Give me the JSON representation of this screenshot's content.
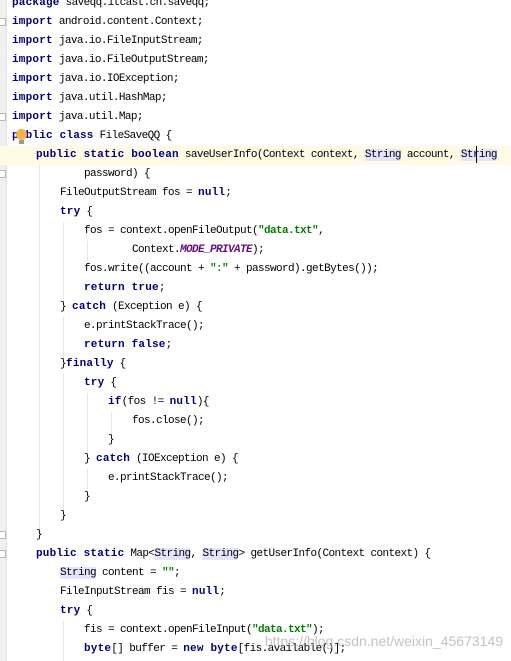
{
  "editor": {
    "current_line": 8,
    "colors": {
      "keyword": "#000080",
      "string": "#008000",
      "constant": "#660e7a",
      "highlight": "#e4e4ff",
      "current_line": "#fffae3"
    },
    "lines": [
      {
        "indent": 0,
        "tokens": [
          [
            "package",
            "k"
          ],
          [
            " saveqq.itcast.cn.saveqq;",
            "p"
          ]
        ]
      },
      {
        "indent": 0,
        "tokens": [
          [
            "import",
            "k"
          ],
          [
            " android.content.Context;",
            "p"
          ]
        ]
      },
      {
        "indent": 0,
        "tokens": [
          [
            "import",
            "k"
          ],
          [
            " java.io.FileInputStream;",
            "p"
          ]
        ]
      },
      {
        "indent": 0,
        "tokens": [
          [
            "import",
            "k"
          ],
          [
            " java.io.FileOutputStream;",
            "p"
          ]
        ]
      },
      {
        "indent": 0,
        "tokens": [
          [
            "import",
            "k"
          ],
          [
            " java.io.IOException;",
            "p"
          ]
        ]
      },
      {
        "indent": 0,
        "tokens": [
          [
            "import",
            "k"
          ],
          [
            " java.util.HashMap;",
            "p"
          ]
        ]
      },
      {
        "indent": 0,
        "tokens": [
          [
            "import",
            "k"
          ],
          [
            " java.util.Map;",
            "p"
          ]
        ]
      },
      {
        "indent": 0,
        "tokens": [
          [
            "public class",
            "k"
          ],
          [
            " FileSaveQQ {",
            "p"
          ]
        ]
      },
      {
        "indent": 4,
        "tokens": [
          [
            "public static boolean",
            "k"
          ],
          [
            " saveUserInfo(Context context, ",
            "p"
          ],
          [
            "String",
            "h"
          ],
          [
            " account, ",
            "p"
          ],
          [
            "String",
            "h"
          ]
        ]
      },
      {
        "indent": 12,
        "tokens": [
          [
            "password) {",
            "p"
          ]
        ]
      },
      {
        "indent": 8,
        "tokens": [
          [
            "FileOutputStream fos = ",
            "p"
          ],
          [
            "null",
            "k"
          ],
          [
            ";",
            "p"
          ]
        ]
      },
      {
        "indent": 8,
        "tokens": [
          [
            "try",
            "k"
          ],
          [
            " {",
            "p"
          ]
        ]
      },
      {
        "indent": 12,
        "tokens": [
          [
            "fos = context.openFileOutput(",
            "p"
          ],
          [
            "\"data.txt\"",
            "s"
          ],
          [
            ",",
            "p"
          ]
        ]
      },
      {
        "indent": 20,
        "tokens": [
          [
            "Context.",
            "p"
          ],
          [
            "MODE_PRIVATE",
            "c"
          ],
          [
            ");",
            "p"
          ]
        ]
      },
      {
        "indent": 12,
        "tokens": [
          [
            "fos.write((account + ",
            "p"
          ],
          [
            "\":\"",
            "s"
          ],
          [
            " + password).getBytes());",
            "p"
          ]
        ]
      },
      {
        "indent": 12,
        "tokens": [
          [
            "return true",
            "k"
          ],
          [
            ";",
            "p"
          ]
        ]
      },
      {
        "indent": 8,
        "tokens": [
          [
            "} ",
            "p"
          ],
          [
            "catch",
            "k"
          ],
          [
            " (Exception e) {",
            "p"
          ]
        ]
      },
      {
        "indent": 12,
        "tokens": [
          [
            "e.printStackTrace();",
            "p"
          ]
        ]
      },
      {
        "indent": 12,
        "tokens": [
          [
            "return false",
            "k"
          ],
          [
            ";",
            "p"
          ]
        ]
      },
      {
        "indent": 8,
        "tokens": [
          [
            "}",
            "p"
          ],
          [
            "finally",
            "k"
          ],
          [
            " {",
            "p"
          ]
        ]
      },
      {
        "indent": 12,
        "tokens": [
          [
            "try",
            "k"
          ],
          [
            " {",
            "p"
          ]
        ]
      },
      {
        "indent": 16,
        "tokens": [
          [
            "if",
            "k"
          ],
          [
            "(fos != ",
            "p"
          ],
          [
            "null",
            "k"
          ],
          [
            "){",
            "p"
          ]
        ]
      },
      {
        "indent": 20,
        "tokens": [
          [
            "fos.close();",
            "p"
          ]
        ]
      },
      {
        "indent": 16,
        "tokens": [
          [
            "}",
            "p"
          ]
        ]
      },
      {
        "indent": 12,
        "tokens": [
          [
            "} ",
            "p"
          ],
          [
            "catch",
            "k"
          ],
          [
            " (IOException e) {",
            "p"
          ]
        ]
      },
      {
        "indent": 16,
        "tokens": [
          [
            "e.printStackTrace();",
            "p"
          ]
        ]
      },
      {
        "indent": 12,
        "tokens": [
          [
            "}",
            "p"
          ]
        ]
      },
      {
        "indent": 8,
        "tokens": [
          [
            "}",
            "p"
          ]
        ]
      },
      {
        "indent": 4,
        "tokens": [
          [
            "}",
            "p"
          ]
        ]
      },
      {
        "indent": 4,
        "tokens": [
          [
            "public static",
            "k"
          ],
          [
            " Map<",
            "p"
          ],
          [
            "String",
            "h"
          ],
          [
            ", ",
            "p"
          ],
          [
            "String",
            "h"
          ],
          [
            "> getUserInfo(Context context) {",
            "p"
          ]
        ]
      },
      {
        "indent": 8,
        "tokens": [
          [
            "String",
            "h"
          ],
          [
            " content = ",
            "p"
          ],
          [
            "\"\"",
            "s"
          ],
          [
            ";",
            "p"
          ]
        ]
      },
      {
        "indent": 8,
        "tokens": [
          [
            "FileInputStream fis = ",
            "p"
          ],
          [
            "null",
            "k"
          ],
          [
            ";",
            "p"
          ]
        ]
      },
      {
        "indent": 8,
        "tokens": [
          [
            "try",
            "k"
          ],
          [
            " {",
            "p"
          ]
        ]
      },
      {
        "indent": 12,
        "tokens": [
          [
            "fis = context.openFileInput(",
            "p"
          ],
          [
            "\"data.txt\"",
            "s"
          ],
          [
            ");",
            "p"
          ]
        ]
      },
      {
        "indent": 12,
        "tokens": [
          [
            "byte",
            "k"
          ],
          [
            "[] buffer = ",
            "p"
          ],
          [
            "new byte",
            "k"
          ],
          [
            "[fis.available()];",
            "p"
          ]
        ]
      }
    ]
  },
  "watermark": "https://blog.csdn.net/weixin_45673149"
}
